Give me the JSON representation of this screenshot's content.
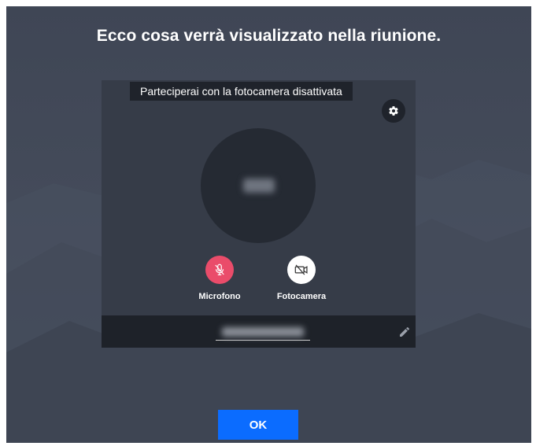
{
  "dialog": {
    "title": "Ecco cosa verrà visualizzato nella riunione.",
    "ok_label": "OK"
  },
  "preview": {
    "camera_off_note": "Parteciperai con la fotocamera disattivata",
    "controls": {
      "microphone_label": "Microfono",
      "camera_label": "Fotocamera"
    }
  },
  "icons": {
    "settings": "gear-icon",
    "microphone": "microphone-off-icon",
    "camera": "camera-off-icon",
    "edit": "pencil-icon"
  },
  "colors": {
    "background": "#444b5a",
    "preview_panel": "#363c48",
    "mic_off": "#ea4c6a",
    "camera_button": "#ffffff",
    "ok_button": "#0b6cff"
  }
}
